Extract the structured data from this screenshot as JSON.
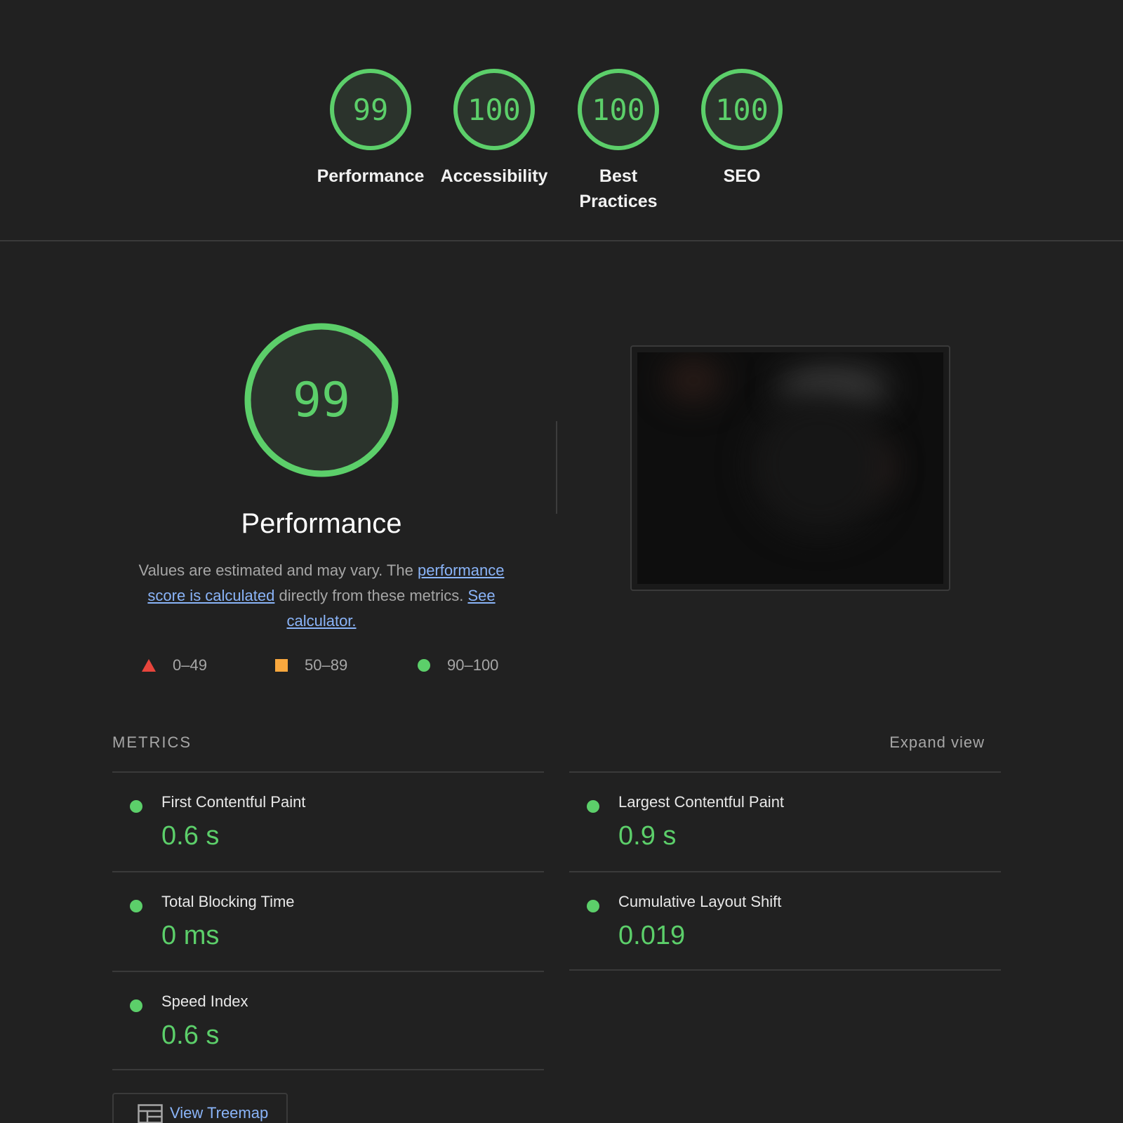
{
  "colors": {
    "background": "#212121",
    "pass_green": "#5ccf6a",
    "ring_fill": "#2b332c",
    "fail_red": "#e8453c",
    "average_orange": "#f9a83e",
    "link_blue": "#8ab4f8",
    "muted_text": "#a6a6a6"
  },
  "scores": [
    {
      "label": "Performance",
      "value": "99"
    },
    {
      "label": "Accessibility",
      "value": "100"
    },
    {
      "label": "Best",
      "label_line2": "Practices",
      "value": "100"
    },
    {
      "label": "SEO",
      "value": "100"
    }
  ],
  "performance": {
    "score": "99",
    "title": "Performance",
    "desc_prefix": "Values are estimated and may vary. The ",
    "desc_link1": "performance score is calculated",
    "desc_middle": " directly from these metrics. ",
    "desc_link2": "See calculator."
  },
  "legend": [
    {
      "icon": "triangle-icon",
      "range": "0–49"
    },
    {
      "icon": "square-icon",
      "range": "50–89"
    },
    {
      "icon": "circle-icon",
      "range": "90–100"
    }
  ],
  "metrics": {
    "header": "METRICS",
    "expand_label": "Expand view",
    "items": [
      {
        "label": "First Contentful Paint",
        "value": "0.6 s"
      },
      {
        "label": "Largest Contentful Paint",
        "value": "0.9 s"
      },
      {
        "label": "Total Blocking Time",
        "value": "0 ms"
      },
      {
        "label": "Cumulative Layout Shift",
        "value": "0.019"
      },
      {
        "label": "Speed Index",
        "value": "0.6 s"
      }
    ]
  },
  "treemap": {
    "label": "View Treemap"
  }
}
